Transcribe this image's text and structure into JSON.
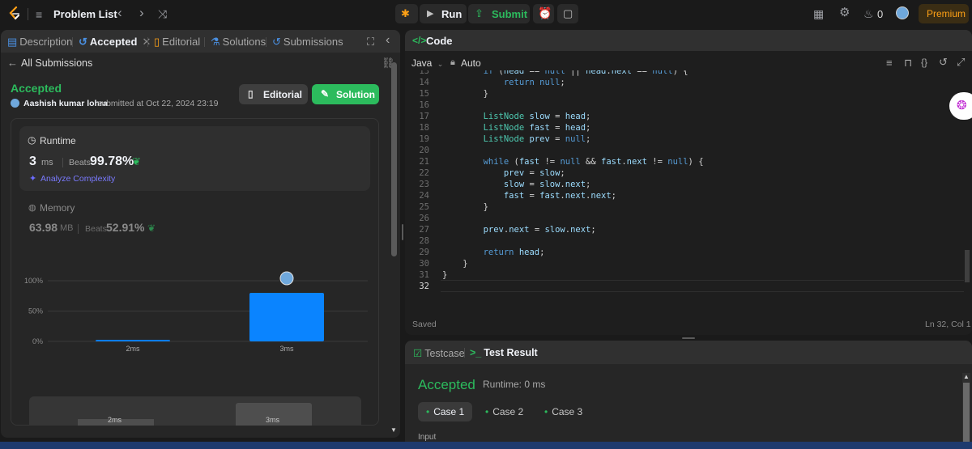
{
  "topbar": {
    "problem_list": "Problem List",
    "run": "Run",
    "submit": "Submit",
    "streak": "0",
    "premium": "Premium"
  },
  "left_tabs": [
    {
      "label": "Description",
      "icon": "description-icon"
    },
    {
      "label": "Accepted",
      "icon": "history-icon"
    },
    {
      "label": "Editorial",
      "icon": "book-icon"
    },
    {
      "label": "Solutions",
      "icon": "flask-icon"
    },
    {
      "label": "Submissions",
      "icon": "history-icon"
    }
  ],
  "submission": {
    "back_label": "All Submissions",
    "status": "Accepted",
    "user": "Aashish kumar lohra",
    "submitted_text": "submitted at Oct 22, 2024 23:19",
    "editorial_btn": "Editorial",
    "solution_btn": "Solution"
  },
  "runtime": {
    "title": "Runtime",
    "value": "3",
    "unit": "ms",
    "beats_label": "Beats",
    "beats_value": "99.78%",
    "analyze": "Analyze Complexity"
  },
  "memory": {
    "title": "Memory",
    "value": "63.98",
    "unit": "MB",
    "beats_label": "Beats",
    "beats_value": "52.91%"
  },
  "chart_data": {
    "type": "bar",
    "categories": [
      "2ms",
      "3ms"
    ],
    "values": [
      2.5,
      80
    ],
    "yticks": [
      "100%",
      "50%",
      "0%"
    ],
    "ylim": [
      0,
      100
    ],
    "grid": true,
    "bar_color": "#0a84ff"
  },
  "mini_chart": {
    "labels": [
      "2ms",
      "3ms"
    ]
  },
  "code": {
    "title": "Code",
    "language": "Java",
    "mode": "Auto",
    "status": "Saved",
    "cursor": "Ln 32, Col 1"
  },
  "testpanel": {
    "testcase_tab": "Testcase",
    "result_tab": "Test Result",
    "status": "Accepted",
    "runtime": "Runtime: 0 ms",
    "cases": [
      "Case 1",
      "Case 2",
      "Case 3"
    ],
    "input_label": "Input"
  },
  "colors": {
    "accent_green": "#2cbb5d",
    "premium": "#ffa116",
    "bar": "#0a84ff"
  }
}
